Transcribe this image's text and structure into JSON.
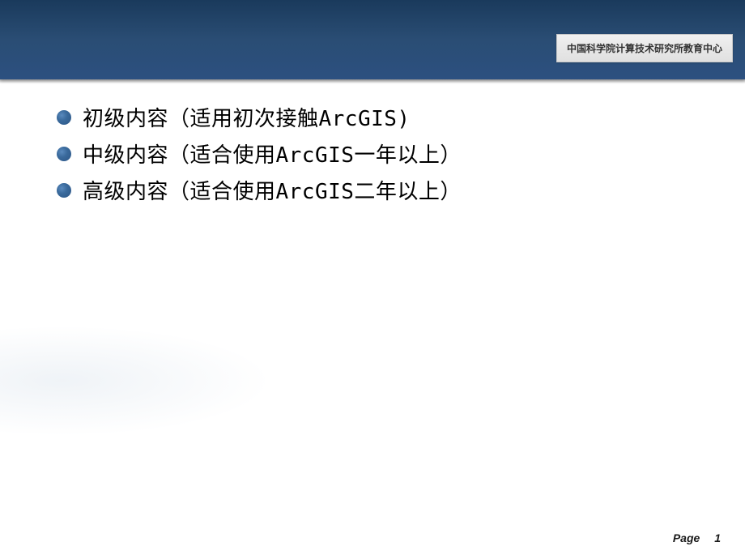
{
  "header": {
    "badge": "中国科学院计算技术研究所教育中心"
  },
  "bullets": [
    {
      "text": "初级内容（适用初次接触ArcGIS)"
    },
    {
      "text": "中级内容（适合使用ArcGIS一年以上）"
    },
    {
      "text": "高级内容（适合使用ArcGIS二年以上）"
    }
  ],
  "footer": {
    "page_label": "Page",
    "page_number": "1"
  }
}
